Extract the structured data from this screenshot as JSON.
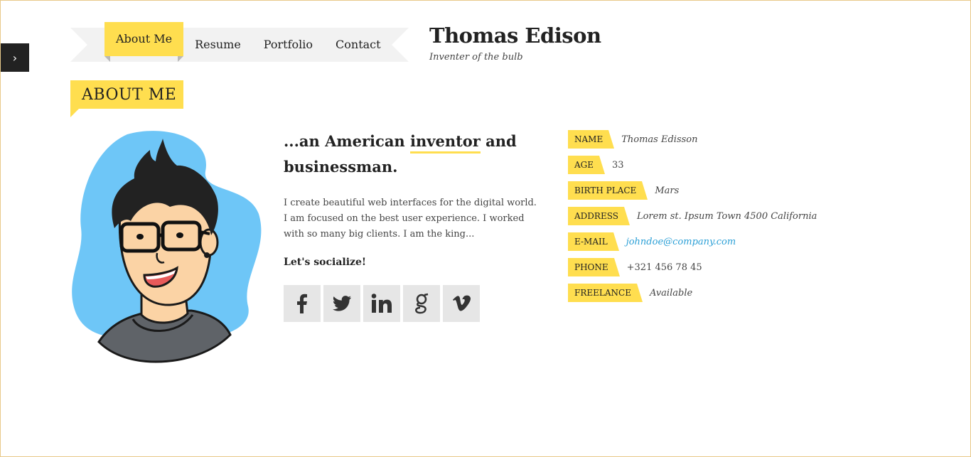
{
  "sidebar_toggle": {
    "icon": "chevron-right-icon",
    "glyph": "›"
  },
  "nav": {
    "items": [
      {
        "label": "About Me",
        "active": true
      },
      {
        "label": "Resume",
        "active": false
      },
      {
        "label": "Portfolio",
        "active": false
      },
      {
        "label": "Contact",
        "active": false
      }
    ]
  },
  "site": {
    "name": "Thomas Edison",
    "tagline": "Inventer of the bulb"
  },
  "section": {
    "title": "ABOUT ME"
  },
  "about": {
    "headline_pre": "...an American ",
    "headline_highlight": "inventor",
    "headline_post": " and businessman.",
    "bio": "I create beautiful web interfaces for the digital world. I am focused on the best user experience. I worked with so many big clients. I am the king...",
    "social_title": "Let's socialize!",
    "social": [
      {
        "name": "facebook-icon",
        "glyph": "f"
      },
      {
        "name": "twitter-icon",
        "glyph": ""
      },
      {
        "name": "linkedin-icon",
        "glyph": "in"
      },
      {
        "name": "google-icon",
        "glyph": "g"
      },
      {
        "name": "vimeo-icon",
        "glyph": "v"
      }
    ]
  },
  "info": [
    {
      "label": "NAME",
      "value": "Thomas Edisson",
      "style": "italic"
    },
    {
      "label": "AGE",
      "value": "33",
      "style": "plain"
    },
    {
      "label": "BIRTH PLACE",
      "value": "Mars",
      "style": "italic"
    },
    {
      "label": "ADDRESS",
      "value": "Lorem st. Ipsum Town 4500 California",
      "style": "italic"
    },
    {
      "label": "E-MAIL",
      "value": "johndoe@company.com",
      "style": "link"
    },
    {
      "label": "PHONE",
      "value": "+321 456 78 45",
      "style": "plain"
    },
    {
      "label": "FREELANCE",
      "value": "Available",
      "style": "italic"
    }
  ],
  "colors": {
    "accent": "#ffde4f",
    "link": "#2a9fd6",
    "ribbon": "#f2f2f2",
    "avatar_blob": "#6ec6f7"
  }
}
